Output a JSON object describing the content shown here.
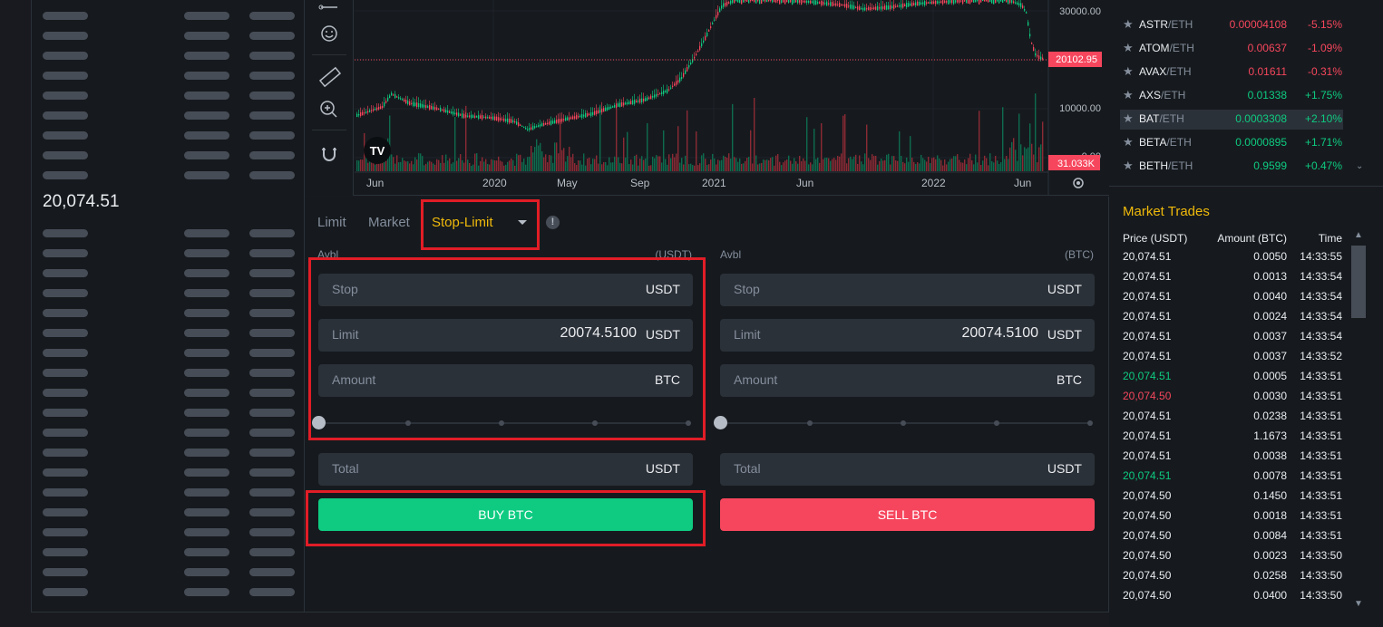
{
  "orderbook": {
    "mid_price": "20,074.51"
  },
  "chart": {
    "price_labels": [
      "30000.00",
      "10000.00",
      "0.00"
    ],
    "last_price_tag": "20102.95",
    "volume_tag": "31.033K",
    "time_labels": [
      "Jun",
      "2020",
      "May",
      "Sep",
      "2021",
      "Jun",
      "2022",
      "Jun"
    ],
    "colors": {
      "up": "#0ecb81",
      "down": "#f6465d",
      "volume_up": "#0e6b4e",
      "volume_down": "#8b2a35"
    }
  },
  "order_form": {
    "tabs": {
      "limit": "Limit",
      "market": "Market",
      "stop_limit": "Stop-Limit",
      "info": "!"
    },
    "buy": {
      "avbl_label": "Avbl",
      "avbl_unit": "(USDT)",
      "stop": {
        "label": "Stop",
        "value": "",
        "unit": "USDT"
      },
      "limit": {
        "label": "Limit",
        "value": "20074.5100",
        "unit": "USDT"
      },
      "amount": {
        "label": "Amount",
        "value": "",
        "unit": "BTC"
      },
      "total": {
        "label": "Total",
        "value": "",
        "unit": "USDT"
      },
      "button": "BUY BTC",
      "slider_percent": 0
    },
    "sell": {
      "avbl_label": "Avbl",
      "avbl_unit": "(BTC)",
      "stop": {
        "label": "Stop",
        "value": "",
        "unit": "USDT"
      },
      "limit": {
        "label": "Limit",
        "value": "20074.5100",
        "unit": "USDT"
      },
      "amount": {
        "label": "Amount",
        "value": "",
        "unit": "BTC"
      },
      "total": {
        "label": "Total",
        "value": "",
        "unit": "USDT"
      },
      "button": "SELL BTC",
      "slider_percent": 0
    }
  },
  "markets": {
    "rows": [
      {
        "base": "ASTR",
        "quote": "/ETH",
        "price": "0.00004108",
        "change": "-5.15%",
        "dir": "down"
      },
      {
        "base": "ATOM",
        "quote": "/ETH",
        "price": "0.00637",
        "change": "-1.09%",
        "dir": "down"
      },
      {
        "base": "AVAX",
        "quote": "/ETH",
        "price": "0.01611",
        "change": "-0.31%",
        "dir": "down"
      },
      {
        "base": "AXS",
        "quote": "/ETH",
        "price": "0.01338",
        "change": "+1.75%",
        "dir": "up"
      },
      {
        "base": "BAT",
        "quote": "/ETH",
        "price": "0.0003308",
        "change": "+2.10%",
        "dir": "up"
      },
      {
        "base": "BETA",
        "quote": "/ETH",
        "price": "0.0000895",
        "change": "+1.71%",
        "dir": "up"
      },
      {
        "base": "BETH",
        "quote": "/ETH",
        "price": "0.9599",
        "change": "+0.47%",
        "dir": "up"
      }
    ]
  },
  "trades": {
    "title": "Market Trades",
    "headers": {
      "price": "Price (USDT)",
      "amount": "Amount (BTC)",
      "time": "Time"
    },
    "rows": [
      {
        "price": "20,074.51",
        "amount": "0.0050",
        "time": "14:33:55",
        "dir": "neutral"
      },
      {
        "price": "20,074.51",
        "amount": "0.0013",
        "time": "14:33:54",
        "dir": "neutral"
      },
      {
        "price": "20,074.51",
        "amount": "0.0040",
        "time": "14:33:54",
        "dir": "neutral"
      },
      {
        "price": "20,074.51",
        "amount": "0.0024",
        "time": "14:33:54",
        "dir": "neutral"
      },
      {
        "price": "20,074.51",
        "amount": "0.0037",
        "time": "14:33:54",
        "dir": "neutral"
      },
      {
        "price": "20,074.51",
        "amount": "0.0037",
        "time": "14:33:52",
        "dir": "neutral"
      },
      {
        "price": "20,074.51",
        "amount": "0.0005",
        "time": "14:33:51",
        "dir": "up"
      },
      {
        "price": "20,074.50",
        "amount": "0.0030",
        "time": "14:33:51",
        "dir": "down"
      },
      {
        "price": "20,074.51",
        "amount": "0.0238",
        "time": "14:33:51",
        "dir": "neutral"
      },
      {
        "price": "20,074.51",
        "amount": "1.1673",
        "time": "14:33:51",
        "dir": "neutral"
      },
      {
        "price": "20,074.51",
        "amount": "0.0038",
        "time": "14:33:51",
        "dir": "neutral"
      },
      {
        "price": "20,074.51",
        "amount": "0.0078",
        "time": "14:33:51",
        "dir": "up"
      },
      {
        "price": "20,074.50",
        "amount": "0.1450",
        "time": "14:33:51",
        "dir": "neutral"
      },
      {
        "price": "20,074.50",
        "amount": "0.0018",
        "time": "14:33:51",
        "dir": "neutral"
      },
      {
        "price": "20,074.50",
        "amount": "0.0084",
        "time": "14:33:51",
        "dir": "neutral"
      },
      {
        "price": "20,074.50",
        "amount": "0.0023",
        "time": "14:33:50",
        "dir": "neutral"
      },
      {
        "price": "20,074.50",
        "amount": "0.0258",
        "time": "14:33:50",
        "dir": "neutral"
      },
      {
        "price": "20,074.50",
        "amount": "0.0400",
        "time": "14:33:50",
        "dir": "neutral"
      }
    ]
  }
}
